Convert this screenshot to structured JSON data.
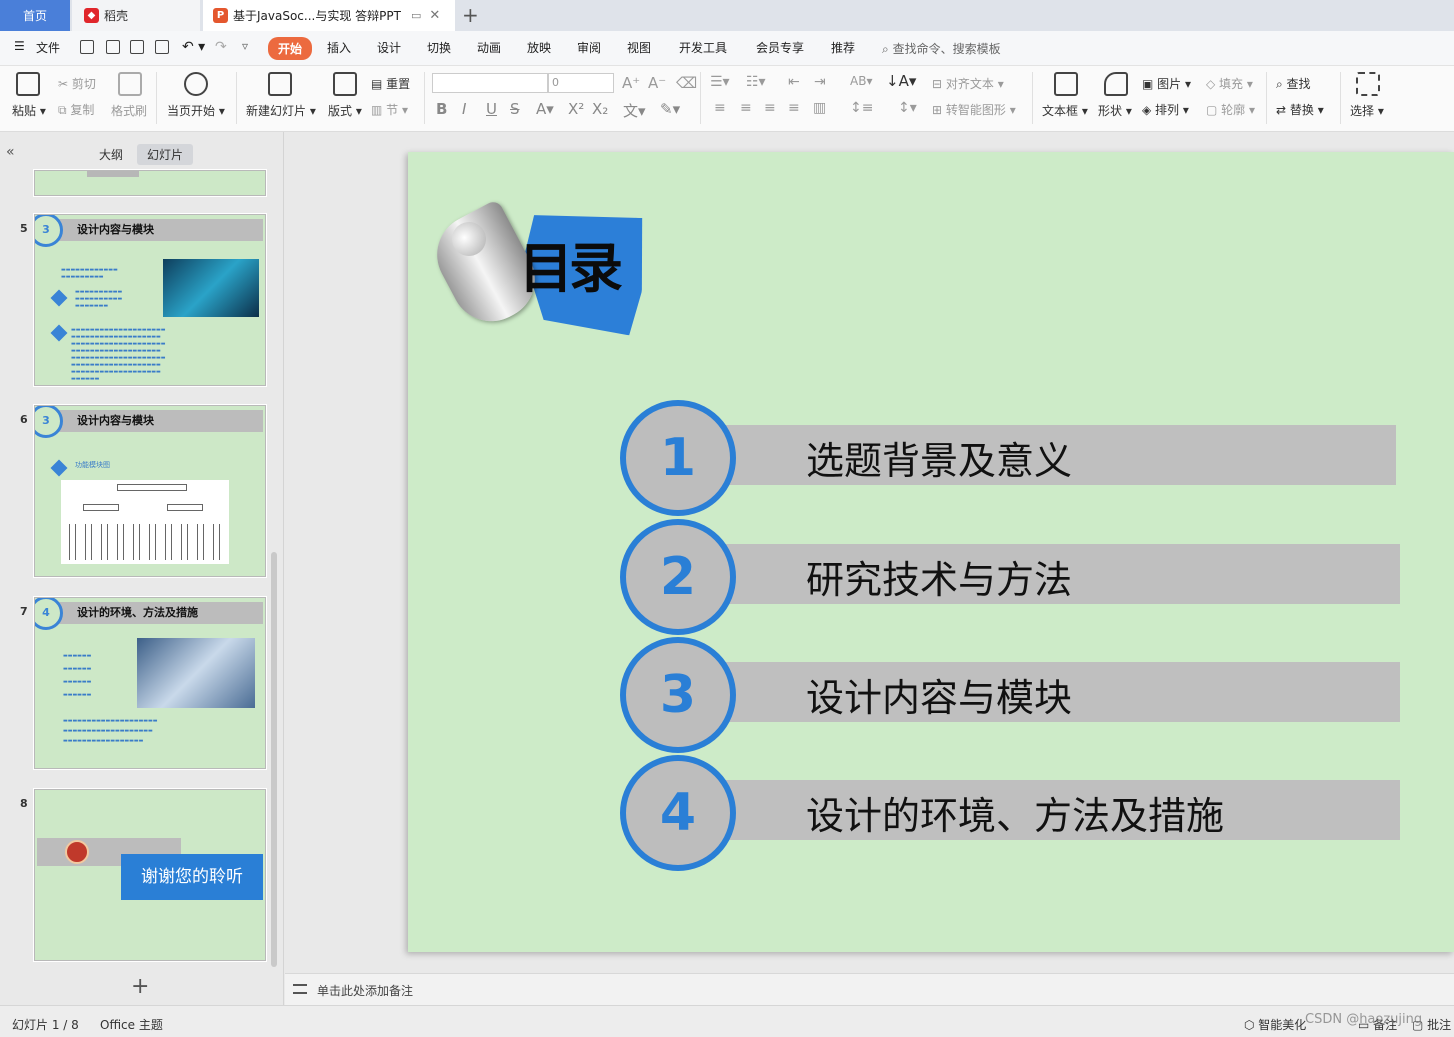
{
  "tabs": {
    "home": "首页",
    "daoke": "稻壳",
    "doc": "基于JavaSoc...与实现 答辩PPT"
  },
  "menu": {
    "file": "文件",
    "items": [
      "开始",
      "插入",
      "设计",
      "切换",
      "动画",
      "放映",
      "审阅",
      "视图",
      "开发工具",
      "会员专享",
      "推荐"
    ],
    "search": "查找命令、搜索模板"
  },
  "ribbon": {
    "paste": "粘贴",
    "cut": "剪切",
    "copy": "复制",
    "format_painter": "格式刷",
    "from_start": "当页开始",
    "new_slide": "新建幻灯片",
    "layout": "版式",
    "reset": "重置",
    "section": "节",
    "font_size": "0",
    "align_text": "对齐文本",
    "smart_art": "转智能图形",
    "textbox": "文本框",
    "shape": "形状",
    "picture": "图片",
    "arrange": "排列",
    "fill": "填充",
    "outline": "轮廓",
    "find": "查找",
    "replace": "替换",
    "select": "选择"
  },
  "left_panel": {
    "outline_tab": "大纲",
    "slides_tab": "幻灯片",
    "thumbnails": [
      {
        "num": "5",
        "section": "3",
        "title": "设计内容与模块"
      },
      {
        "num": "6",
        "section": "3",
        "title": "设计内容与模块",
        "sub": "功能模块图"
      },
      {
        "num": "7",
        "section": "4",
        "title": "设计的环境、方法及措施"
      },
      {
        "num": "8",
        "title": "谢谢您的聆听"
      }
    ]
  },
  "slide": {
    "title": "目录",
    "items": [
      {
        "num": "1",
        "label": "选题背景及意义"
      },
      {
        "num": "2",
        "label": "研究技术与方法"
      },
      {
        "num": "3",
        "label": "设计内容与模块"
      },
      {
        "num": "4",
        "label": "设计的环境、方法及措施"
      }
    ]
  },
  "notes_placeholder": "单击此处添加备注",
  "status": {
    "slide_counter": "幻灯片 1 / 8",
    "theme": "Office 主题",
    "smart_beautify": "智能美化",
    "notes": "备注",
    "comments": "批注",
    "watermark": "CSDN @haozujing"
  },
  "colors": {
    "accent": "#2a7fd6",
    "slide_bg": "#cdebc8",
    "bar_gray": "#bfbfbf",
    "start_tab": "#ec6a3f"
  }
}
